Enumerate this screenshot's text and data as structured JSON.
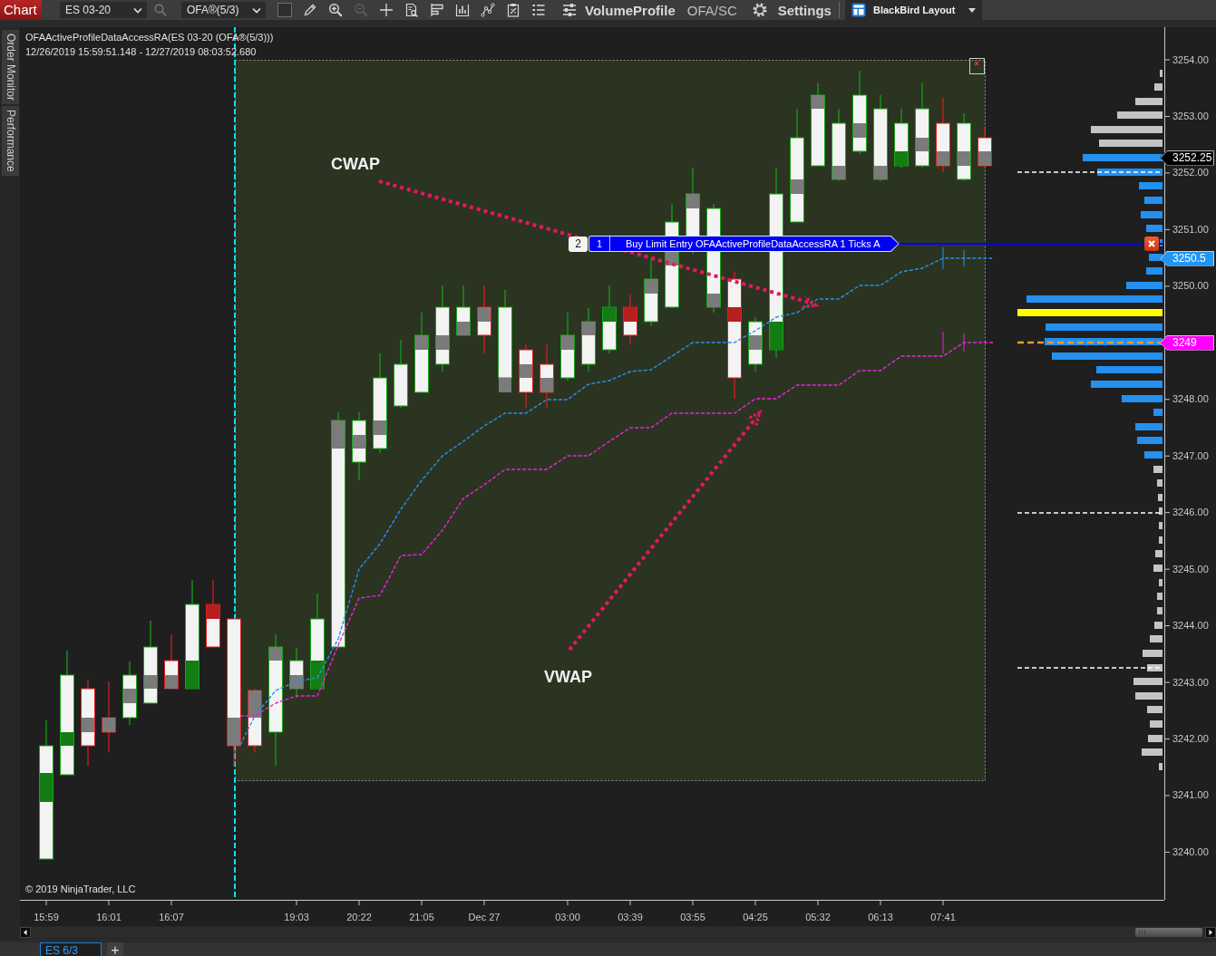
{
  "toolbar": {
    "window_tab": "Chart",
    "instrument": "ES 03-20",
    "bar_type": "OFA®(5/3)",
    "tools": [
      {
        "disabled": false
      },
      {
        "disabled": false
      },
      {
        "disabled": false
      },
      {
        "disabled": true
      },
      {
        "disabled": false
      },
      {
        "disabled": false
      },
      {
        "disabled": false
      },
      {
        "disabled": false
      },
      {
        "disabled": false
      },
      {
        "disabled": false
      },
      {
        "disabled": false
      },
      {
        "disabled": false
      }
    ],
    "indicator": "VolumeProfile",
    "template": "OFA/SC",
    "settings": "Settings",
    "layout": "BlackBird Layout"
  },
  "side_tabs": [
    "Order Monitor",
    "Performance"
  ],
  "chart": {
    "title": "OFAActiveProfileDataAccessRA(ES 03-20 (OFA®(5/3)))",
    "range": "12/26/2019 15:59:51.148 - 12/27/2019 08:03:52.680",
    "annotations": [
      "CWAP",
      "VWAP"
    ],
    "order": {
      "quantity": "2",
      "count": "1",
      "label": "Buy Limit Entry OFAActiveProfileDataAccessRA 1 Ticks A"
    },
    "copyright": "© 2019 NinjaTrader, LLC",
    "price_ticks": [
      "3254.00",
      "3253.00",
      "3252.00",
      "3251.00",
      "3250.00",
      "3248.00",
      "3247.00",
      "3246.00",
      "3245.00",
      "3244.00",
      "3243.00",
      "3242.00",
      "3241.00",
      "3240.00"
    ],
    "price_markers": [
      {
        "text": "3252.25",
        "color": "#000000"
      },
      {
        "text": "3250.5",
        "color": "#2196f3"
      },
      {
        "text": "3249",
        "color": "#ff00ff"
      }
    ],
    "time_ticks": [
      "15:59",
      "16:01",
      "16:07",
      "19:03",
      "20:22",
      "21:05",
      "Dec 27",
      "03:00",
      "03:39",
      "03:55",
      "04:25",
      "05:32",
      "06:13",
      "07:41"
    ]
  },
  "tabs": [
    {
      "label": "ES 6/3",
      "selected": true
    }
  ],
  "new_tab": "+"
}
